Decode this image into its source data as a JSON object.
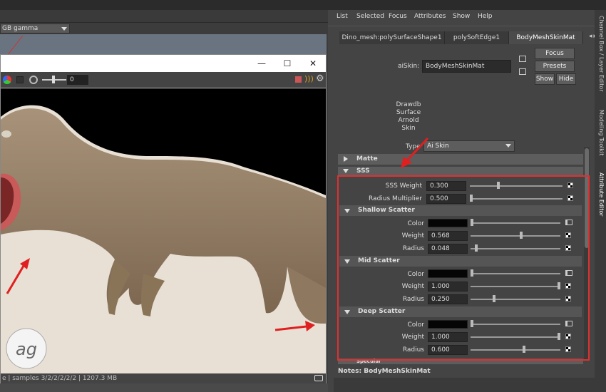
{
  "viewport": {
    "gamma_label": "GB gamma"
  },
  "render_view": {
    "exposure_value": "0",
    "status_text": "e  | samples 3/2/2/2/2/2 | 1207.3 MB"
  },
  "attribute_editor": {
    "menu": [
      "List",
      "Selected",
      "Focus",
      "Attributes",
      "Show",
      "Help"
    ],
    "tabs": [
      "Dino_mesh:polySurfaceShape1",
      "polySoftEdge1",
      "BodyMeshSkinMat"
    ],
    "node_type_label": "aiSkin:",
    "node_name": "BodyMeshSkinMat",
    "buttons": {
      "focus": "Focus",
      "presets": "Presets",
      "show": "Show",
      "hide": "Hide"
    },
    "classification": [
      "Drawdb",
      "Surface",
      "Arnold",
      "Skin"
    ],
    "type_label": "Type",
    "type_value": "Ai Skin",
    "sections": {
      "matte": "Matte",
      "sss": "SSS",
      "specular": "Specular"
    },
    "sss": {
      "weight_label": "SSS Weight",
      "weight_value": "0.300",
      "radius_mult_label": "Radius Multiplier",
      "radius_mult_value": "0.500"
    },
    "scatter_layers": [
      {
        "title": "Shallow Scatter",
        "color_label": "Color",
        "weight_label": "Weight",
        "weight": "0.568",
        "radius_label": "Radius",
        "radius": "0.048"
      },
      {
        "title": "Mid Scatter",
        "color_label": "Color",
        "weight_label": "Weight",
        "weight": "1.000",
        "radius_label": "Radius",
        "radius": "0.250"
      },
      {
        "title": "Deep Scatter",
        "color_label": "Color",
        "weight_label": "Weight",
        "weight": "1.000",
        "radius_label": "Radius",
        "radius": "0.600"
      }
    ],
    "notes_label": "Notes:",
    "notes_value": "BodyMeshSkinMat",
    "side_tabs": [
      "Channel Box / Layer Editor",
      "Modeling Toolkit",
      "Attribute Editor"
    ]
  },
  "colors": {
    "highlight_red": "#e03030",
    "panel_bg": "#444444",
    "field_bg": "#2b2b2b"
  },
  "slider_levels": {
    "sss_weight": 0.3,
    "radius_multiplier": 0.0,
    "shallow_weight": 0.568,
    "shallow_radius": 0.048,
    "mid_weight": 1.0,
    "mid_radius": 0.25,
    "deep_weight": 1.0,
    "deep_radius": 0.6
  }
}
